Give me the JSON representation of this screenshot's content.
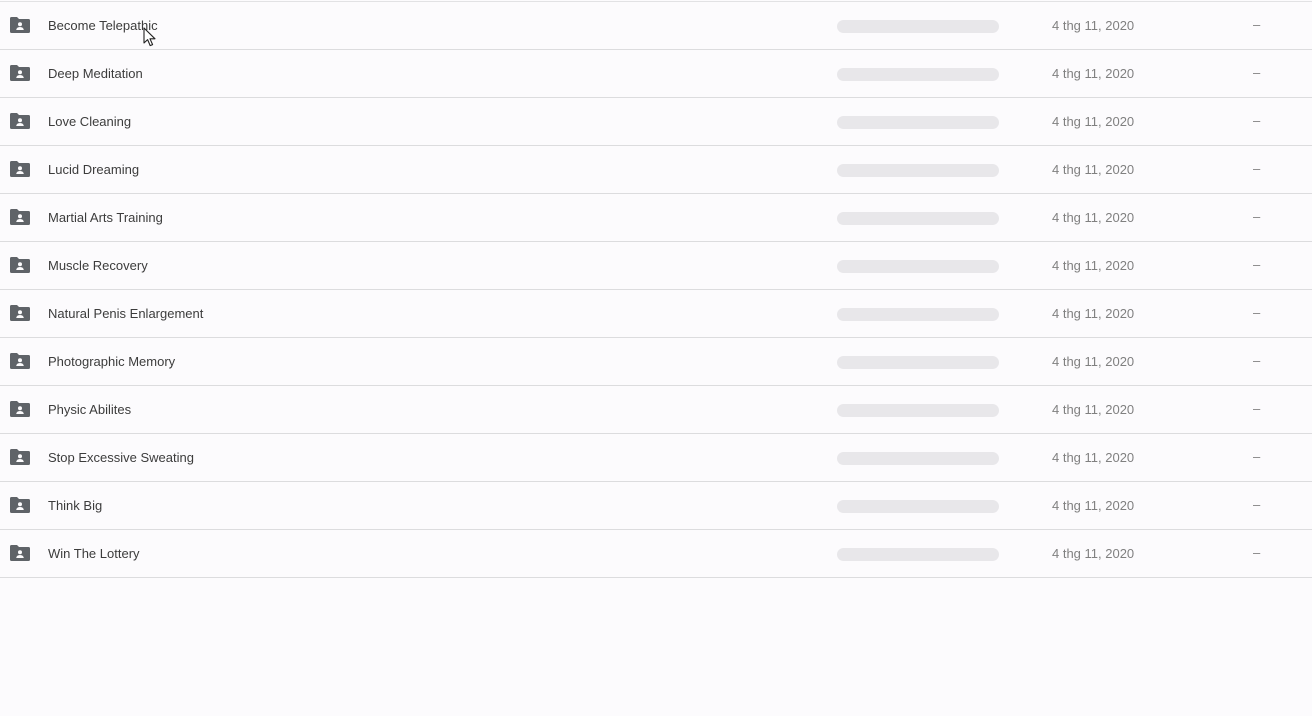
{
  "rows": [
    {
      "name": "Become Telepathic",
      "date": "4 thg 11, 2020",
      "size": "–"
    },
    {
      "name": "Deep Meditation",
      "date": "4 thg 11, 2020",
      "size": "–"
    },
    {
      "name": "Love Cleaning",
      "date": "4 thg 11, 2020",
      "size": "–"
    },
    {
      "name": "Lucid Dreaming",
      "date": "4 thg 11, 2020",
      "size": "–"
    },
    {
      "name": "Martial Arts Training",
      "date": "4 thg 11, 2020",
      "size": "–"
    },
    {
      "name": "Muscle Recovery",
      "date": "4 thg 11, 2020",
      "size": "–"
    },
    {
      "name": "Natural Penis Enlargement",
      "date": "4 thg 11, 2020",
      "size": "–"
    },
    {
      "name": "Photographic Memory",
      "date": "4 thg 11, 2020",
      "size": "–"
    },
    {
      "name": "Physic Abilites",
      "date": "4 thg 11, 2020",
      "size": "–"
    },
    {
      "name": "Stop Excessive Sweating",
      "date": "4 thg 11, 2020",
      "size": "–"
    },
    {
      "name": "Think Big",
      "date": "4 thg 11, 2020",
      "size": "–"
    },
    {
      "name": "Win The Lottery",
      "date": "4 thg 11, 2020",
      "size": "–"
    }
  ],
  "icons": {
    "row_icon": "shared-folder-icon",
    "cursor": "mouse-pointer-icon"
  },
  "colors": {
    "background": "#fcfbfd",
    "icon": "#5f6368",
    "placeholder": "#e8e7ea",
    "divider": "#dcdcde"
  }
}
